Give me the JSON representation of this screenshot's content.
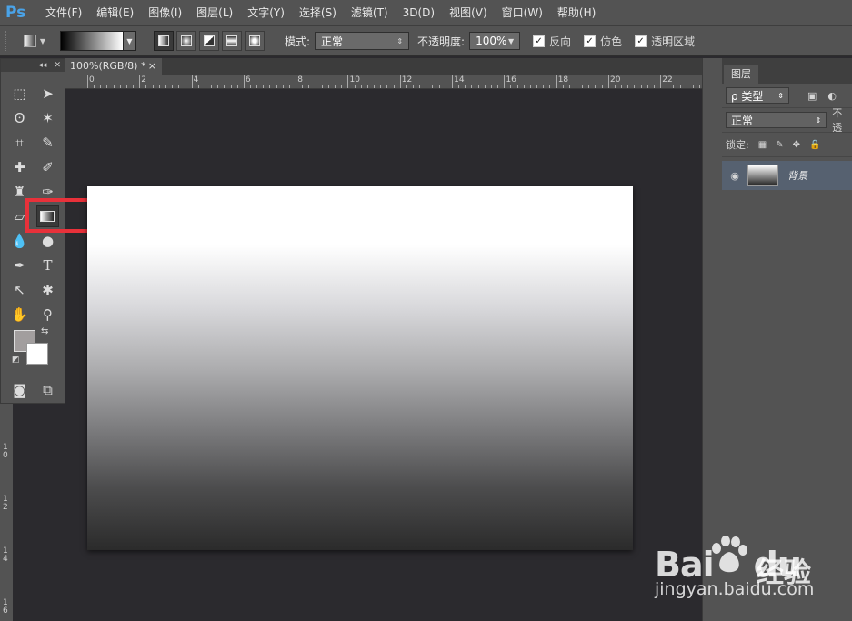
{
  "app": {
    "logo": "Ps"
  },
  "menus": [
    "文件(F)",
    "编辑(E)",
    "图像(I)",
    "图层(L)",
    "文字(Y)",
    "选择(S)",
    "滤镜(T)",
    "3D(D)",
    "视图(V)",
    "窗口(W)",
    "帮助(H)"
  ],
  "options": {
    "mode_label": "模式:",
    "mode_value": "正常",
    "opacity_label": "不透明度:",
    "opacity_value": "100%",
    "reverse_label": "反向",
    "dither_label": "仿色",
    "transparency_label": "透明区域"
  },
  "document": {
    "tab_title": "100%(RGB/8) *",
    "close": "×"
  },
  "ruler": {
    "h_ticks": [
      "0",
      "2",
      "4",
      "6",
      "8",
      "10",
      "12",
      "14",
      "16",
      "18",
      "20",
      "22"
    ],
    "v_ticks": [
      "1\n0",
      "1\n2",
      "1\n4",
      "1\n6"
    ]
  },
  "layers_panel": {
    "tab": "图层",
    "filter_label": "ρ 类型",
    "blend_mode": "正常",
    "opacity_label": "不透",
    "lock_label": "锁定:",
    "layer_name": "背景"
  },
  "watermark": {
    "brand": "Bai",
    "brand2": "du",
    "product": "经验",
    "url": "jingyan.baidu.com"
  }
}
